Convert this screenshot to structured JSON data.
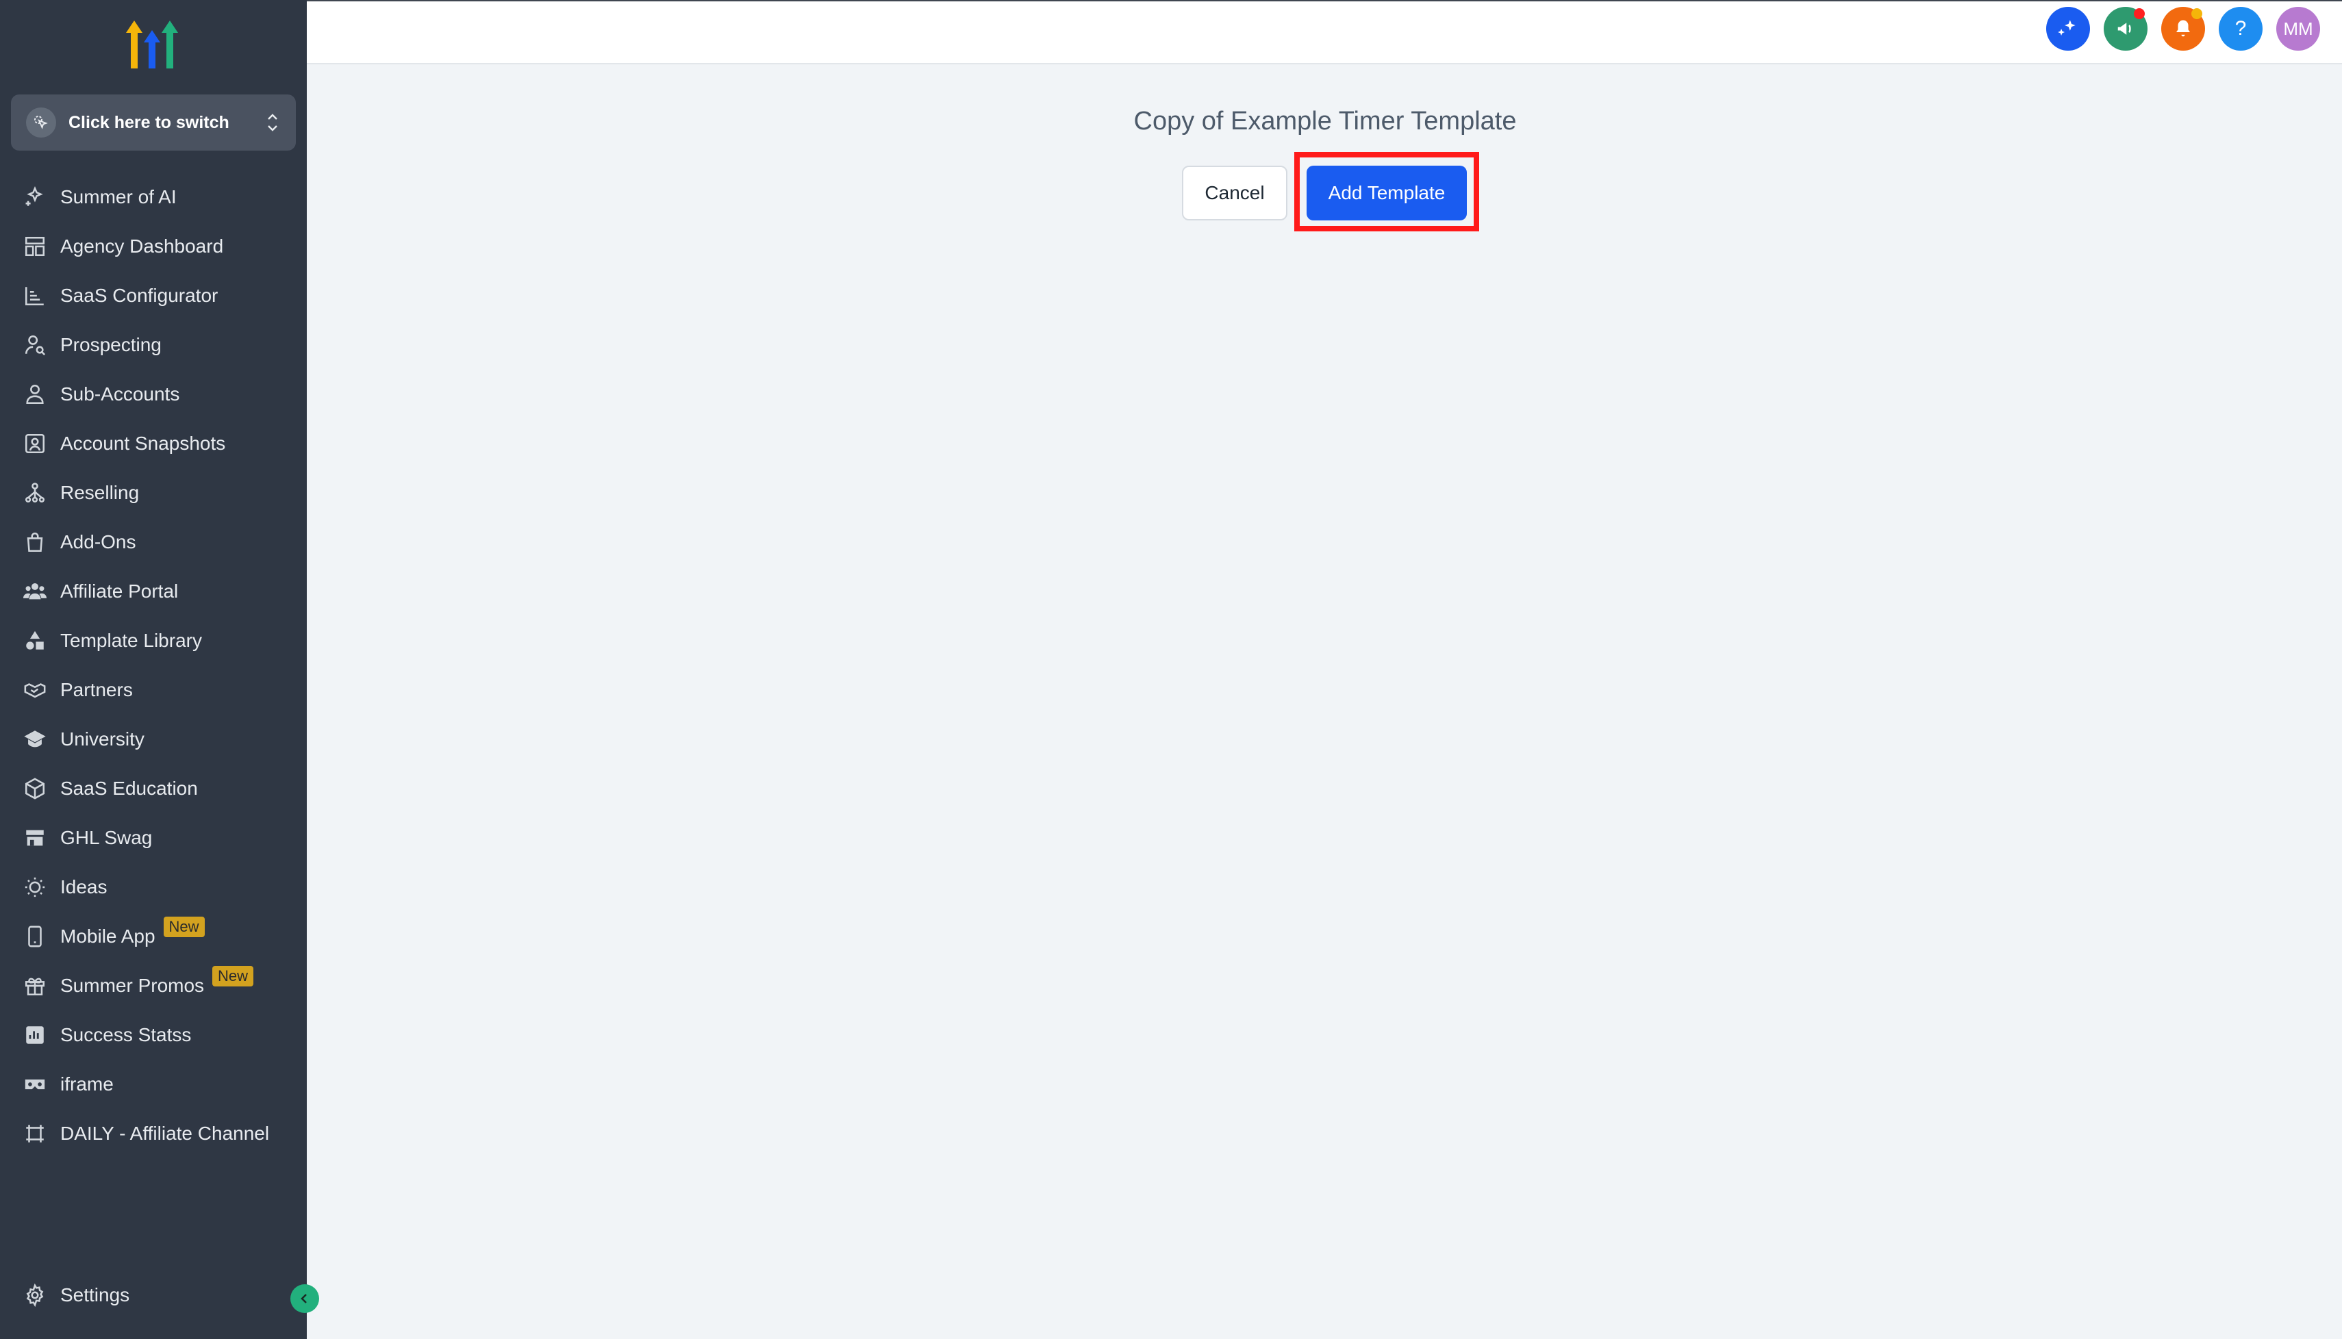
{
  "brand": {
    "logo_icon": "arrows-up-logo",
    "colors": [
      "#f5b50a",
      "#1a5cf0",
      "#22b07d"
    ]
  },
  "switcher": {
    "label": "Click here to switch"
  },
  "nav": {
    "items": [
      {
        "label": "Summer of AI",
        "icon": "sparkle-icon"
      },
      {
        "label": "Agency Dashboard",
        "icon": "dashboard-icon"
      },
      {
        "label": "SaaS Configurator",
        "icon": "chart-icon"
      },
      {
        "label": "Prospecting",
        "icon": "user-search-icon"
      },
      {
        "label": "Sub-Accounts",
        "icon": "user-icon"
      },
      {
        "label": "Account Snapshots",
        "icon": "snapshot-icon"
      },
      {
        "label": "Reselling",
        "icon": "network-icon"
      },
      {
        "label": "Add-Ons",
        "icon": "bag-icon"
      },
      {
        "label": "Affiliate Portal",
        "icon": "users-icon"
      },
      {
        "label": "Template Library",
        "icon": "shapes-icon"
      },
      {
        "label": "Partners",
        "icon": "handshake-icon"
      },
      {
        "label": "University",
        "icon": "graduation-cap-icon"
      },
      {
        "label": "SaaS Education",
        "icon": "cube-icon"
      },
      {
        "label": "GHL Swag",
        "icon": "store-icon"
      },
      {
        "label": "Ideas",
        "icon": "lightbulb-icon"
      },
      {
        "label": "Mobile App",
        "icon": "mobile-icon",
        "badge": "New"
      },
      {
        "label": "Summer Promos",
        "icon": "gift-icon",
        "badge": "New"
      },
      {
        "label": "Success Statss",
        "icon": "stats-icon"
      },
      {
        "label": "iframe",
        "icon": "vr-icon"
      },
      {
        "label": "DAILY - Affiliate Channel",
        "icon": "frame-icon"
      }
    ]
  },
  "settings": {
    "label": "Settings",
    "icon": "gear-icon"
  },
  "topbar": {
    "buttons": [
      {
        "icon": "ai-sparkle-icon",
        "color": "#1a5cf0"
      },
      {
        "icon": "megaphone-icon",
        "color": "#2e9a6f"
      },
      {
        "icon": "bell-icon",
        "color": "#f26a0f"
      },
      {
        "icon": "help-icon",
        "label": "?",
        "color": "#1e8df0"
      },
      {
        "icon": "avatar",
        "label": "MM",
        "color": "#b77ad0"
      }
    ]
  },
  "main": {
    "title": "Copy of Example Timer Template",
    "cancel_label": "Cancel",
    "add_label": "Add Template"
  }
}
